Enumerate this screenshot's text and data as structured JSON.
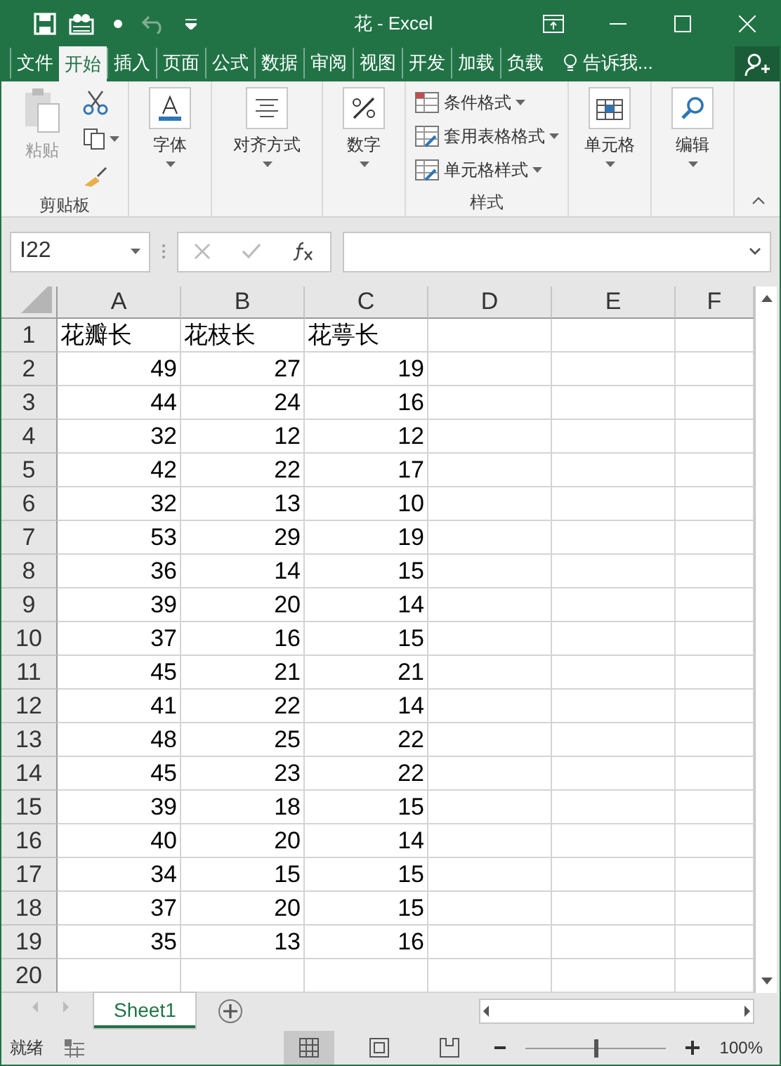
{
  "window": {
    "title": "花 - Excel"
  },
  "tabs": [
    {
      "label": "文件",
      "selected": false
    },
    {
      "label": "开始",
      "selected": true
    },
    {
      "label": "插入",
      "selected": false
    },
    {
      "label": "页面",
      "selected": false
    },
    {
      "label": "公式",
      "selected": false
    },
    {
      "label": "数据",
      "selected": false
    },
    {
      "label": "审阅",
      "selected": false
    },
    {
      "label": "视图",
      "selected": false
    },
    {
      "label": "开发",
      "selected": false
    },
    {
      "label": "加载",
      "selected": false
    },
    {
      "label": "负载",
      "selected": false
    }
  ],
  "tell_me": "告诉我...",
  "ribbon": {
    "clipboard": {
      "paste": "粘贴",
      "label": "剪贴板"
    },
    "big_buttons_1": [
      {
        "label": "字体",
        "kind": "font"
      },
      {
        "label": "对齐方式",
        "kind": "align"
      },
      {
        "label": "数字",
        "kind": "number"
      }
    ],
    "styles": {
      "items": [
        "条件格式",
        "套用表格格式",
        "单元格样式"
      ],
      "label": "样式"
    },
    "big_buttons_2": [
      {
        "label": "单元格",
        "kind": "cells"
      },
      {
        "label": "编辑",
        "kind": "edit"
      }
    ]
  },
  "name_box": "I22",
  "columns": [
    "A",
    "B",
    "C",
    "D",
    "E",
    "F"
  ],
  "rows": [
    {
      "number": "1",
      "kind": "text",
      "cells": [
        "花瓣长",
        "花枝长",
        "花萼长"
      ]
    },
    {
      "number": "2",
      "kind": "number",
      "cells": [
        "49",
        "27",
        "19"
      ]
    },
    {
      "number": "3",
      "kind": "number",
      "cells": [
        "44",
        "24",
        "16"
      ]
    },
    {
      "number": "4",
      "kind": "number",
      "cells": [
        "32",
        "12",
        "12"
      ]
    },
    {
      "number": "5",
      "kind": "number",
      "cells": [
        "42",
        "22",
        "17"
      ]
    },
    {
      "number": "6",
      "kind": "number",
      "cells": [
        "32",
        "13",
        "10"
      ]
    },
    {
      "number": "7",
      "kind": "number",
      "cells": [
        "53",
        "29",
        "19"
      ]
    },
    {
      "number": "8",
      "kind": "number",
      "cells": [
        "36",
        "14",
        "15"
      ]
    },
    {
      "number": "9",
      "kind": "number",
      "cells": [
        "39",
        "20",
        "14"
      ]
    },
    {
      "number": "10",
      "kind": "number",
      "cells": [
        "37",
        "16",
        "15"
      ]
    },
    {
      "number": "11",
      "kind": "number",
      "cells": [
        "45",
        "21",
        "21"
      ]
    },
    {
      "number": "12",
      "kind": "number",
      "cells": [
        "41",
        "22",
        "14"
      ]
    },
    {
      "number": "13",
      "kind": "number",
      "cells": [
        "48",
        "25",
        "22"
      ]
    },
    {
      "number": "14",
      "kind": "number",
      "cells": [
        "45",
        "23",
        "22"
      ]
    },
    {
      "number": "15",
      "kind": "number",
      "cells": [
        "39",
        "18",
        "15"
      ]
    },
    {
      "number": "16",
      "kind": "number",
      "cells": [
        "40",
        "20",
        "14"
      ]
    },
    {
      "number": "17",
      "kind": "number",
      "cells": [
        "34",
        "15",
        "15"
      ]
    },
    {
      "number": "18",
      "kind": "number",
      "cells": [
        "37",
        "20",
        "15"
      ]
    },
    {
      "number": "19",
      "kind": "number",
      "cells": [
        "35",
        "13",
        "16"
      ]
    },
    {
      "number": "20",
      "cells": []
    }
  ],
  "sheets": [
    {
      "label": "Sheet1",
      "selected": true
    }
  ],
  "status": {
    "text": "就绪",
    "zoom": "100%",
    "level": 0.5
  }
}
